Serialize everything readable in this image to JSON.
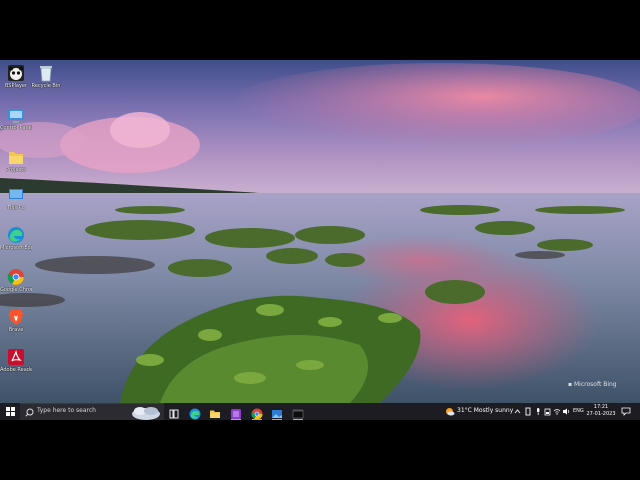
{
  "desktop": {
    "icons": [
      {
        "name": "bsplayer",
        "label": "BSPlayer",
        "icon": "panda-icon"
      },
      {
        "name": "recycle-bin",
        "label": "Recycle Bin",
        "icon": "recycle-bin-icon"
      },
      {
        "name": "control-panel",
        "label": "Control Panel",
        "icon": "control-panel-icon"
      },
      {
        "name": "projects",
        "label": "Projects",
        "icon": "folder-icon"
      },
      {
        "name": "this-pc",
        "label": "This PC",
        "icon": "computer-icon"
      },
      {
        "name": "microsoft-edge",
        "label": "Microsoft Edge",
        "icon": "edge-icon"
      },
      {
        "name": "google-chrome",
        "label": "Google Chrome",
        "icon": "chrome-icon"
      },
      {
        "name": "brave",
        "label": "Brave",
        "icon": "brave-icon"
      },
      {
        "name": "adobe-reader",
        "label": "Adobe Reader XI",
        "icon": "acrobat-icon"
      }
    ],
    "watermark": "Microsoft Bing"
  },
  "taskbar": {
    "search_placeholder": "Type here to search",
    "weather": "31°C  Mostly sunny",
    "language": "ENG",
    "time": "17:21",
    "date": "27-01-2023",
    "apps": [
      "task-view",
      "edge",
      "file-explorer",
      "onenote",
      "chrome",
      "photos",
      "terminal"
    ],
    "accent": "#76b9ed",
    "background": "#1c1c22"
  }
}
